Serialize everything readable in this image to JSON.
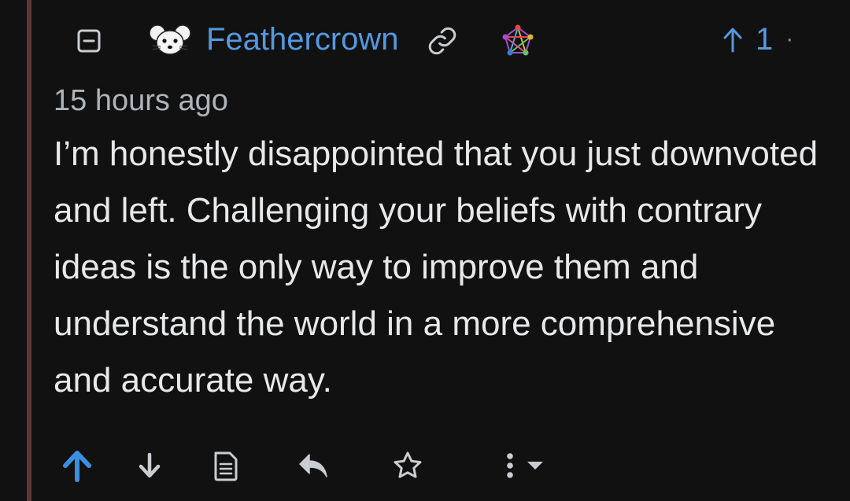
{
  "comment": {
    "username": "Feathercrown",
    "score": "1",
    "score_separator": "·",
    "timestamp": "15 hours ago",
    "body": "I’m honestly disappointed that you just downvoted and left. Challenging your beliefs with contrary ideas is the only way to improve them and understand the world in a more comprehensive and accurate way."
  },
  "icons": {
    "collapse": "minus-square-icon",
    "avatar": "mouse-face-avatar",
    "link": "link-icon",
    "instance": "fediverse-pentagram-icon",
    "score_arrow": "arrow-up-icon",
    "upvote": "arrow-up-icon",
    "downvote": "arrow-down-icon",
    "view_source": "file-text-icon",
    "reply": "reply-icon",
    "save": "star-icon",
    "more": "more-vertical-icon",
    "dropdown": "caret-down-icon"
  },
  "colors": {
    "background": "#111111",
    "thread_line": "#5b3836",
    "username": "#5499e0",
    "upvoted": "#3b8fe0",
    "text": "#e6e8ea",
    "muted": "#aeb4ba"
  }
}
